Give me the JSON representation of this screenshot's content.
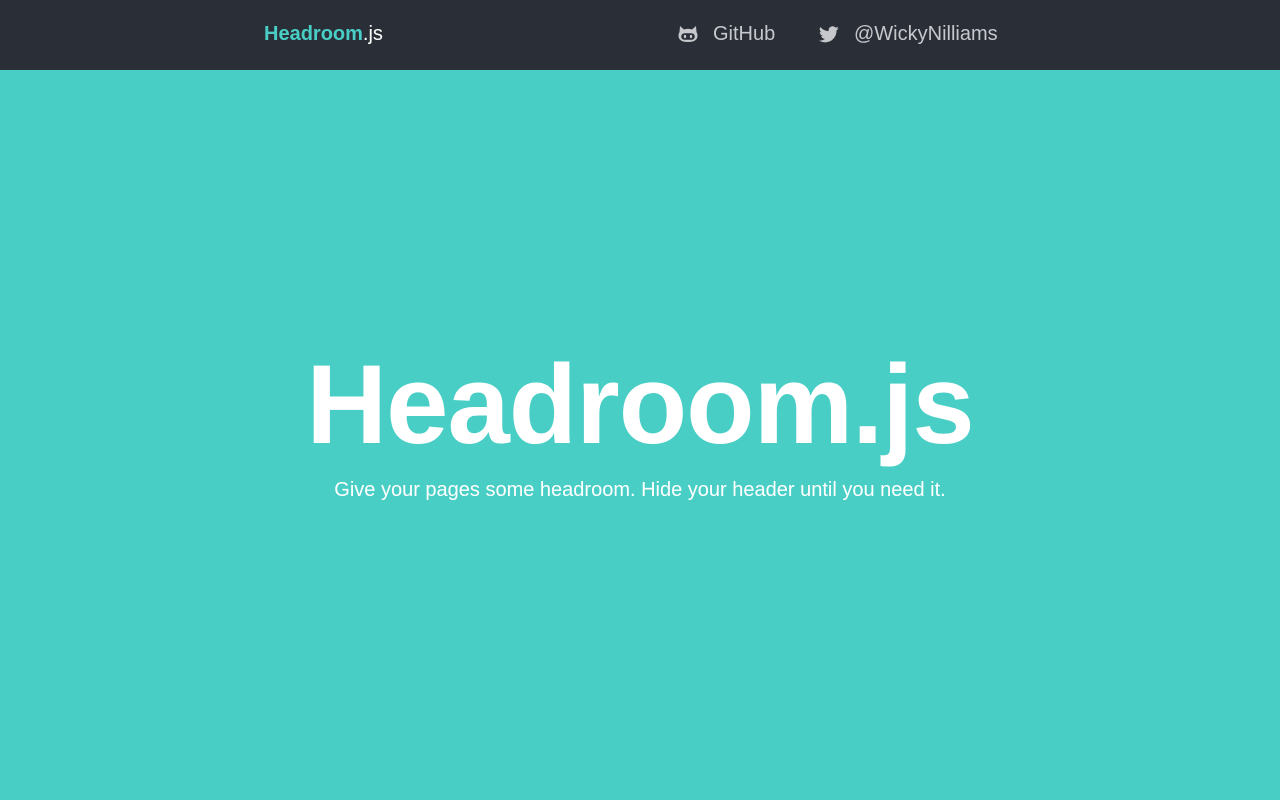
{
  "header": {
    "brand": {
      "name": "Headroom",
      "suffix": ".js"
    },
    "nav": [
      {
        "label": "GitHub",
        "icon": "github-octocat-icon"
      },
      {
        "label": "@WickyNilliams",
        "icon": "twitter-bird-icon"
      }
    ]
  },
  "hero": {
    "title": "Headroom.js",
    "tagline": "Give your pages some headroom. Hide your header until you need it."
  },
  "colors": {
    "accent": "#49cec6",
    "header_bg": "#2a2e37",
    "nav_text": "#c6c8cc",
    "hero_text": "#ffffff"
  }
}
